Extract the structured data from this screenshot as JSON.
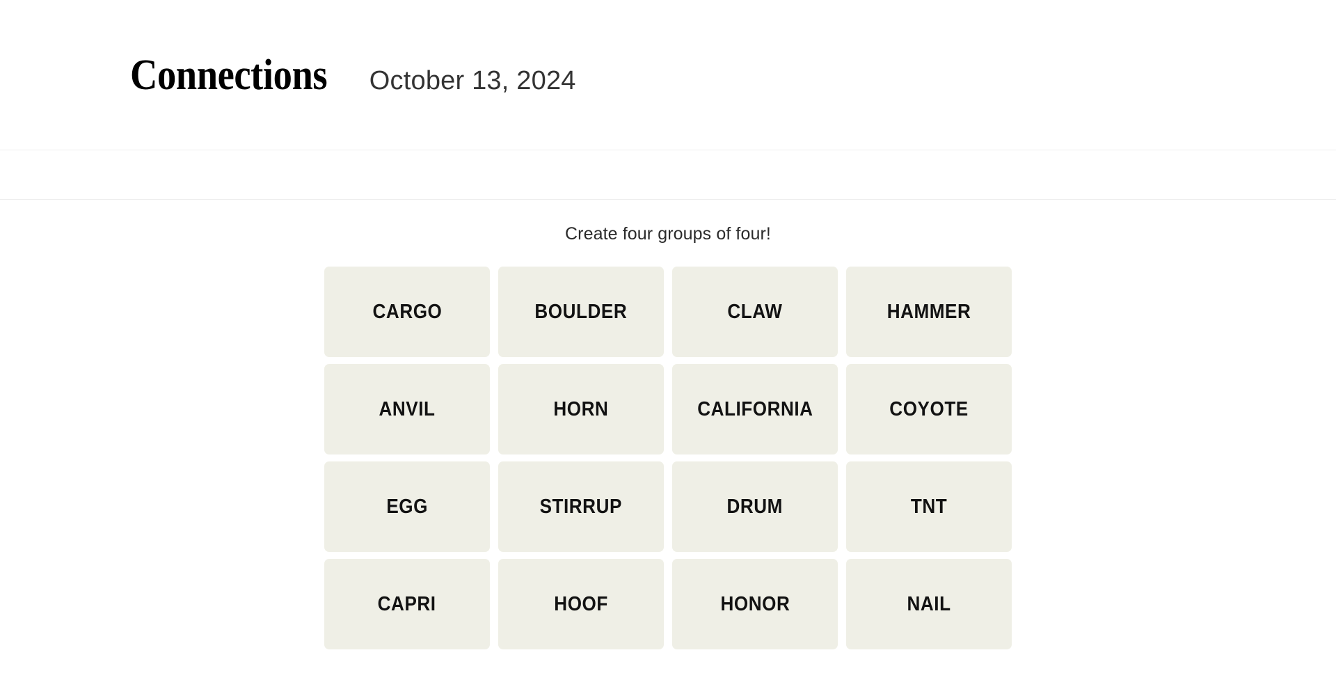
{
  "header": {
    "game_title": "Connections",
    "date": "October 13, 2024"
  },
  "toolbar": {
    "items": []
  },
  "game": {
    "instruction": "Create four groups of four!",
    "colors": {
      "page_background": "#ffffff",
      "tile_background": "#efefe6",
      "tile_text": "#121212",
      "divider": "#ededed",
      "instruction_text": "#2b2b2b",
      "date_text": "#333333",
      "title_text": "#000000"
    },
    "grid": {
      "columns": 4,
      "rows": 4,
      "tiles": [
        {
          "label": "CARGO",
          "row": 1,
          "col": 1,
          "selected": false
        },
        {
          "label": "BOULDER",
          "row": 1,
          "col": 2,
          "selected": false
        },
        {
          "label": "CLAW",
          "row": 1,
          "col": 3,
          "selected": false
        },
        {
          "label": "HAMMER",
          "row": 1,
          "col": 4,
          "selected": false
        },
        {
          "label": "ANVIL",
          "row": 2,
          "col": 1,
          "selected": false
        },
        {
          "label": "HORN",
          "row": 2,
          "col": 2,
          "selected": false
        },
        {
          "label": "CALIFORNIA",
          "row": 2,
          "col": 3,
          "selected": false
        },
        {
          "label": "COYOTE",
          "row": 2,
          "col": 4,
          "selected": false
        },
        {
          "label": "EGG",
          "row": 3,
          "col": 1,
          "selected": false
        },
        {
          "label": "STIRRUP",
          "row": 3,
          "col": 2,
          "selected": false
        },
        {
          "label": "DRUM",
          "row": 3,
          "col": 3,
          "selected": false
        },
        {
          "label": "TNT",
          "row": 3,
          "col": 4,
          "selected": false
        },
        {
          "label": "CAPRI",
          "row": 4,
          "col": 1,
          "selected": false
        },
        {
          "label": "HOOF",
          "row": 4,
          "col": 2,
          "selected": false
        },
        {
          "label": "HONOR",
          "row": 4,
          "col": 3,
          "selected": false
        },
        {
          "label": "NAIL",
          "row": 4,
          "col": 4,
          "selected": false
        }
      ]
    }
  }
}
